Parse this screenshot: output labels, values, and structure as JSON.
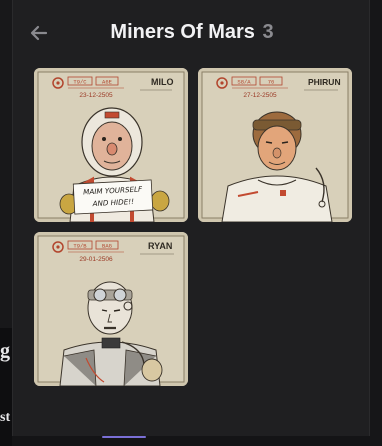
{
  "header": {
    "title": "Miners Of Mars",
    "count": "3"
  },
  "cards": [
    {
      "name": "MILO",
      "id": "T9/C",
      "code": "A6E",
      "date": "23-12-2505",
      "sign": [
        "MAIM YOURSELF",
        "AND HIDE!!"
      ]
    },
    {
      "name": "PHIRUN",
      "id": "S8/A",
      "code": "76",
      "date": "27-12-2505"
    },
    {
      "name": "RYAN",
      "id": "T9/B",
      "code": "BAG",
      "date": "29-01-2506"
    }
  ],
  "background": {
    "fragment_1": "g",
    "fragment_2": "st"
  },
  "colors": {
    "panel": "#1f1f21",
    "card_paper": "#cdc4ad",
    "accent": "#7a6fd6"
  }
}
